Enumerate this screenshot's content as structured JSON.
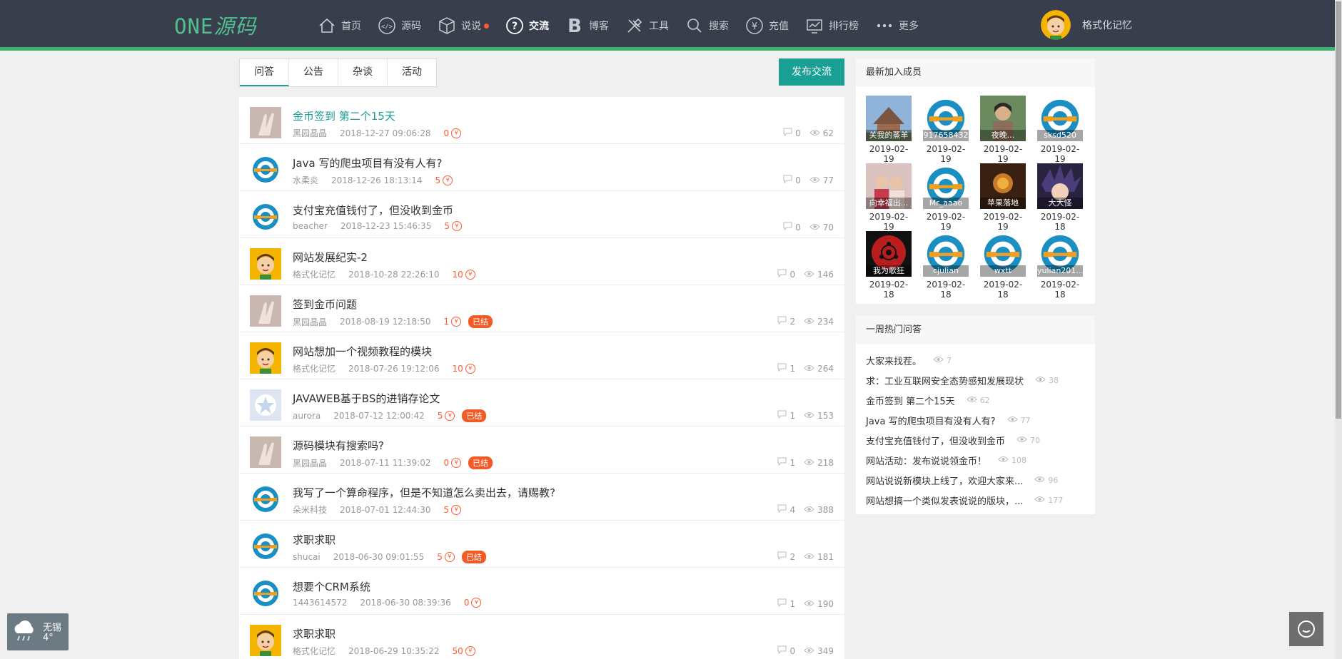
{
  "logo": {
    "en": "ONE",
    "cn": "源码"
  },
  "nav": [
    {
      "label": "首页",
      "icon": "home-icon"
    },
    {
      "label": "源码",
      "icon": "code-icon"
    },
    {
      "label": "说说",
      "icon": "cube-icon"
    },
    {
      "label": "交流",
      "icon": "question-icon"
    },
    {
      "label": "博客",
      "icon": "blog-b-icon"
    },
    {
      "label": "工具",
      "icon": "tools-icon"
    },
    {
      "label": "搜索",
      "icon": "search-icon"
    },
    {
      "label": "充值",
      "icon": "yen-icon"
    },
    {
      "label": "排行榜",
      "icon": "chart-icon"
    },
    {
      "label": "更多",
      "icon": "more-icon"
    }
  ],
  "user": {
    "name": "格式化记忆"
  },
  "tabs": [
    "问答",
    "公告",
    "杂谈",
    "活动"
  ],
  "publish_label": "发布交流",
  "posts": [
    {
      "title": "金币签到 第二个15天",
      "author": "黑园晶晶",
      "date": "2018-12-27 09:06:28",
      "coins": "0",
      "badge": "",
      "comments": "0",
      "views": "62",
      "avatar": "hand"
    },
    {
      "title": "Java 写的爬虫项目有没有人有?",
      "author": "水柔炎",
      "date": "2018-12-26 18:13:14",
      "coins": "5",
      "badge": "",
      "comments": "0",
      "views": "77",
      "avatar": "logo"
    },
    {
      "title": "支付宝充值钱付了，但没收到金币",
      "author": "beacher",
      "date": "2018-12-23 15:46:35",
      "coins": "5",
      "badge": "",
      "comments": "0",
      "views": "70",
      "avatar": "logo"
    },
    {
      "title": "网站发展纪实-2",
      "author": "格式化记忆",
      "date": "2018-10-28 22:26:10",
      "coins": "10",
      "badge": "",
      "comments": "0",
      "views": "146",
      "avatar": "face"
    },
    {
      "title": "签到金币问题",
      "author": "黑园晶晶",
      "date": "2018-08-19 12:18:50",
      "coins": "1",
      "badge": "已结",
      "comments": "2",
      "views": "234",
      "avatar": "hand"
    },
    {
      "title": "网站想加一个视频教程的模块",
      "author": "格式化记忆",
      "date": "2018-07-26 19:12:06",
      "coins": "10",
      "badge": "",
      "comments": "1",
      "views": "264",
      "avatar": "face"
    },
    {
      "title": "JAVAWEB基于BS的进销存论文",
      "author": "aurora",
      "date": "2018-07-12 12:00:42",
      "coins": "5",
      "badge": "已结",
      "comments": "1",
      "views": "153",
      "avatar": "star"
    },
    {
      "title": "源码模块有搜索吗?",
      "author": "黑园晶晶",
      "date": "2018-07-11 11:39:02",
      "coins": "0",
      "badge": "已结",
      "comments": "1",
      "views": "218",
      "avatar": "hand"
    },
    {
      "title": "我写了一个算命程序，但是不知道怎么卖出去，请赐教?",
      "author": "朵米科技",
      "date": "2018-07-01 12:44:30",
      "coins": "5",
      "badge": "",
      "comments": "4",
      "views": "388",
      "avatar": "logo"
    },
    {
      "title": "求职求职",
      "author": "shucai",
      "date": "2018-06-30 09:01:55",
      "coins": "5",
      "badge": "已结",
      "comments": "2",
      "views": "181",
      "avatar": "logo"
    },
    {
      "title": "想要个CRM系统",
      "author": "1443614572",
      "date": "2018-06-30 08:39:36",
      "coins": "0",
      "badge": "",
      "comments": "1",
      "views": "190",
      "avatar": "logo"
    },
    {
      "title": "求职求职",
      "author": "格式化记忆",
      "date": "2018-06-29 10:35:22",
      "coins": "50",
      "badge": "",
      "comments": "0",
      "views": "349",
      "avatar": "face"
    }
  ],
  "new_members": {
    "heading": "最新加入成员",
    "items": [
      {
        "name": "关我的蒸羊",
        "date": "2019-02-19",
        "pic": "photo-temple"
      },
      {
        "name": "917658432",
        "date": "2019-02-19",
        "pic": "logo"
      },
      {
        "name": "夜晚...",
        "date": "2019-02-19",
        "pic": "photo-person"
      },
      {
        "name": "sksd520",
        "date": "2019-02-19",
        "pic": "logo"
      },
      {
        "name": "向幸福出...",
        "date": "2019-02-19",
        "pic": "photo-kids"
      },
      {
        "name": "Mr_aaao",
        "date": "2019-02-19",
        "pic": "logo"
      },
      {
        "name": "苹果落地",
        "date": "2019-02-19",
        "pic": "photo-dark"
      },
      {
        "name": "大大怪",
        "date": "2019-02-18",
        "pic": "anime"
      },
      {
        "name": "我为歌狂",
        "date": "2019-02-18",
        "pic": "sharingan"
      },
      {
        "name": "cjulian",
        "date": "2019-02-18",
        "pic": "logo"
      },
      {
        "name": "wxtt",
        "date": "2019-02-18",
        "pic": "logo"
      },
      {
        "name": "yulian201...",
        "date": "2019-02-18",
        "pic": "logo"
      }
    ]
  },
  "hot": {
    "heading": "一周热门问答",
    "items": [
      {
        "title": "大家来找茬。",
        "views": "7"
      },
      {
        "title": "求：工业互联网安全态势感知发展现状",
        "views": "38"
      },
      {
        "title": "金币签到 第二个15天",
        "views": "62"
      },
      {
        "title": "Java 写的爬虫项目有没有人有?",
        "views": "77"
      },
      {
        "title": "支付宝充值钱付了，但没收到金币",
        "views": "70"
      },
      {
        "title": "网站活动：发布说说领金币！",
        "views": "108"
      },
      {
        "title": "网站说说新模块上线了，欢迎大家来...",
        "views": "96"
      },
      {
        "title": "网站想搞一个类似发表说说的版块，...",
        "views": "177"
      }
    ]
  },
  "weather": {
    "city": "无锡",
    "temp": "4°"
  },
  "colors": {
    "accent": "#1aa093",
    "topbar": "#383e4b",
    "badge": "#f25a26",
    "coin": "#ff5a33"
  }
}
